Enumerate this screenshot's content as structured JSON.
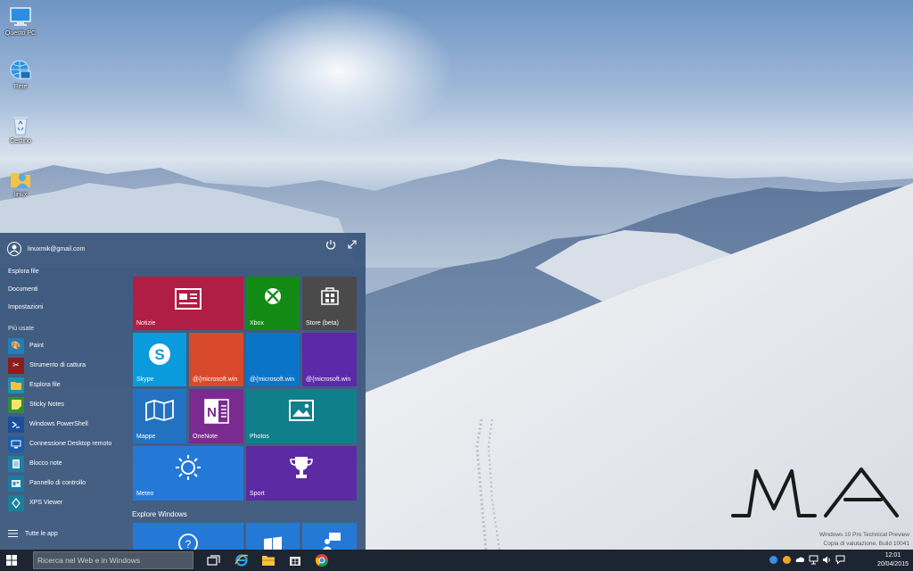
{
  "desktop": {
    "icons": [
      {
        "label": "Questo PC",
        "icon": "computer-icon"
      },
      {
        "label": "Rete",
        "icon": "network-icon"
      },
      {
        "label": "Cestino",
        "icon": "recycle-bin-icon"
      },
      {
        "label": "linux",
        "icon": "user-folder-icon"
      }
    ],
    "watermark_logo_text": "MA",
    "watermark_line1": "Windows 10 Pro Technical Preview",
    "watermark_line2": "Copia di valutazione. Build 10041"
  },
  "start_menu": {
    "user": "linuxmik@gmail.com",
    "places": [
      "Esplora file",
      "Documenti",
      "Impostazioni"
    ],
    "most_used_label": "Più usate",
    "apps": [
      {
        "label": "Paint",
        "icon": "paint-icon",
        "color": "#1f7fb8"
      },
      {
        "label": "Strumento di cattura",
        "icon": "snipping-tool-icon",
        "color": "#8a1c1c"
      },
      {
        "label": "Esplora file",
        "icon": "folder-icon",
        "color": "#1e8fa8"
      },
      {
        "label": "Sticky Notes",
        "icon": "sticky-notes-icon",
        "color": "#2f8e3a"
      },
      {
        "label": "Windows PowerShell",
        "icon": "powershell-icon",
        "color": "#1b4f9b"
      },
      {
        "label": "Connessione Desktop remoto",
        "icon": "remote-desktop-icon",
        "color": "#1b5eae"
      },
      {
        "label": "Blocco note",
        "icon": "notepad-icon",
        "color": "#1e7fa6"
      },
      {
        "label": "Pannello di controllo",
        "icon": "control-panel-icon",
        "color": "#1c7aa3"
      },
      {
        "label": "XPS Viewer",
        "icon": "xps-viewer-icon",
        "color": "#1a7f9a"
      }
    ],
    "all_apps": "Tutte le app",
    "explore_label": "Explore Windows",
    "tiles": [
      {
        "label": "Notizie",
        "color": "#b01d45",
        "icon": "news-icon"
      },
      {
        "label": "Xbox",
        "color": "#138a13",
        "icon": "xbox-icon"
      },
      {
        "label": "Store (beta)",
        "color": "#4a4a4a",
        "icon": "store-icon"
      },
      {
        "label": "Skype",
        "color": "#0a9bdc",
        "icon": "skype-icon"
      },
      {
        "label": "@{microsoft.win",
        "color": "#d9492b",
        "icon": ""
      },
      {
        "label": "@{microsoft.win",
        "color": "#0a74c9",
        "icon": ""
      },
      {
        "label": "@{microsoft.win",
        "color": "#5a2aa8",
        "icon": ""
      },
      {
        "label": "Mappe",
        "color": "#2272c2",
        "icon": "maps-icon"
      },
      {
        "label": "OneNote",
        "color": "#7b2b8f",
        "icon": "onenote-icon"
      },
      {
        "label": "Photos",
        "color": "#0f7f8c",
        "icon": "photos-icon"
      },
      {
        "label": "Meteo",
        "color": "#2579d6",
        "icon": "weather-icon"
      },
      {
        "label": "Sport",
        "color": "#5c2aa3",
        "icon": "trophy-icon"
      }
    ]
  },
  "taskbar": {
    "search_placeholder": "Ricerca nel Web e in Windows",
    "time": "12:01",
    "date": "20/04/2015"
  }
}
